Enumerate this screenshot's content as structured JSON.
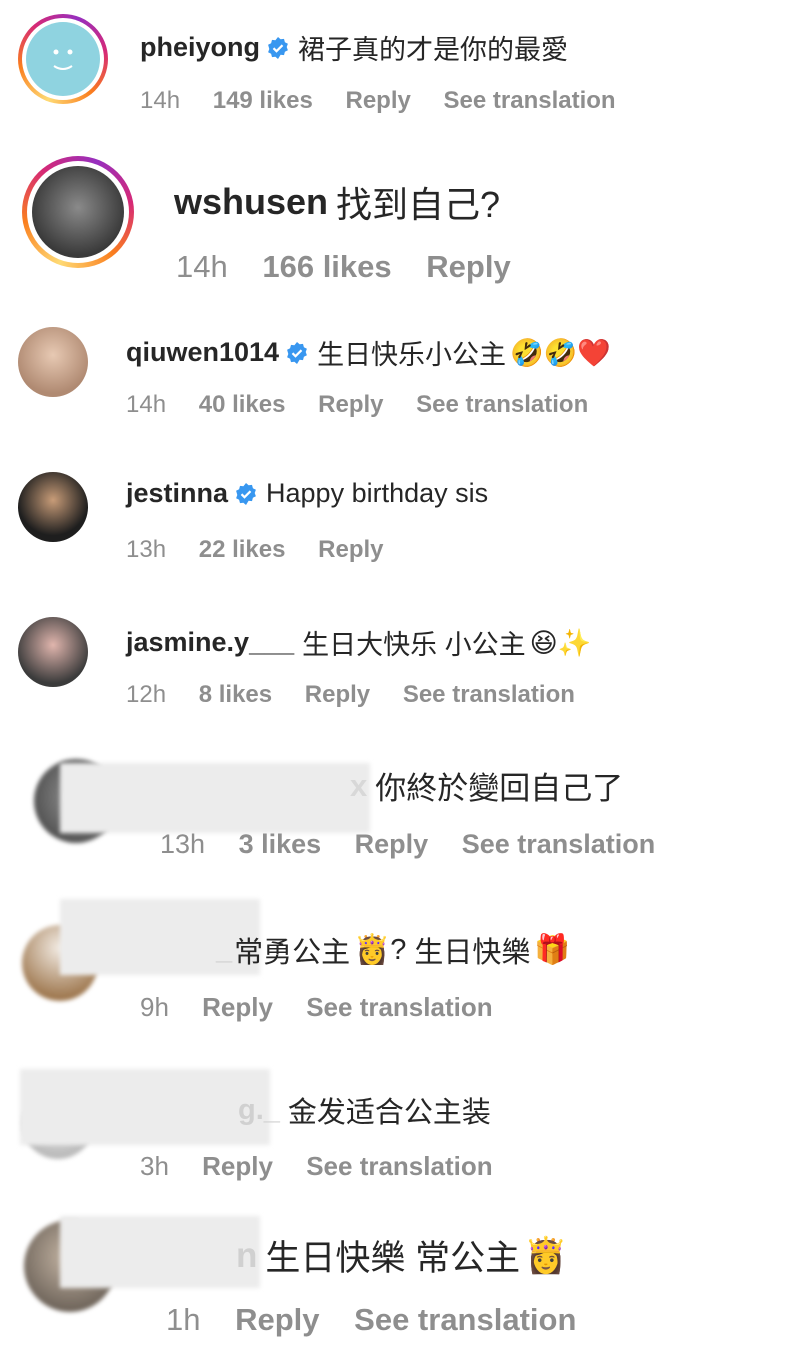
{
  "comments": [
    {
      "username": "pheiyong",
      "verified": true,
      "text": "裙子真的才是你的最愛",
      "emoji": "",
      "time": "14h",
      "likes": "149 likes",
      "reply": "Reply",
      "translate": "See translation"
    },
    {
      "username": "wshusen",
      "verified": false,
      "text": "找到自己?",
      "emoji": "",
      "time": "14h",
      "likes": "166 likes",
      "reply": "Reply",
      "translate": ""
    },
    {
      "username": "qiuwen1014",
      "verified": true,
      "text": "生日快乐小公主",
      "emoji": "🤣🤣❤️",
      "time": "14h",
      "likes": "40 likes",
      "reply": "Reply",
      "translate": "See translation"
    },
    {
      "username": "jestinna",
      "verified": true,
      "text": "Happy birthday sis",
      "emoji": "",
      "time": "13h",
      "likes": "22 likes",
      "reply": "Reply",
      "translate": ""
    },
    {
      "username": "jasmine.y___",
      "verified": false,
      "text": "生日大快乐 小公主",
      "emoji": "😆✨",
      "time": "12h",
      "likes": "8 likes",
      "reply": "Reply",
      "translate": "See translation"
    },
    {
      "username": "x",
      "verified": false,
      "text": "你終於變回自己了",
      "emoji": "",
      "time": "13h",
      "likes": "3 likes",
      "reply": "Reply",
      "translate": "See translation"
    },
    {
      "username": "_",
      "verified": false,
      "text": "常勇公主",
      "emoji": "👸?",
      "text2": "生日快樂",
      "emoji2": "🎁",
      "time": "9h",
      "likes": "",
      "reply": "Reply",
      "translate": "See translation"
    },
    {
      "username": "g._",
      "verified": false,
      "text": "金发适合公主装",
      "emoji": "",
      "time": "3h",
      "likes": "",
      "reply": "Reply",
      "translate": "See translation"
    },
    {
      "username": "n",
      "verified": false,
      "text": "生日快樂 常公主",
      "emoji": "👸",
      "time": "1h",
      "likes": "",
      "reply": "Reply",
      "translate": "See translation"
    }
  ],
  "colors": {
    "text": "#262626",
    "meta": "#8e8e8e",
    "verified": "#3897f0"
  }
}
